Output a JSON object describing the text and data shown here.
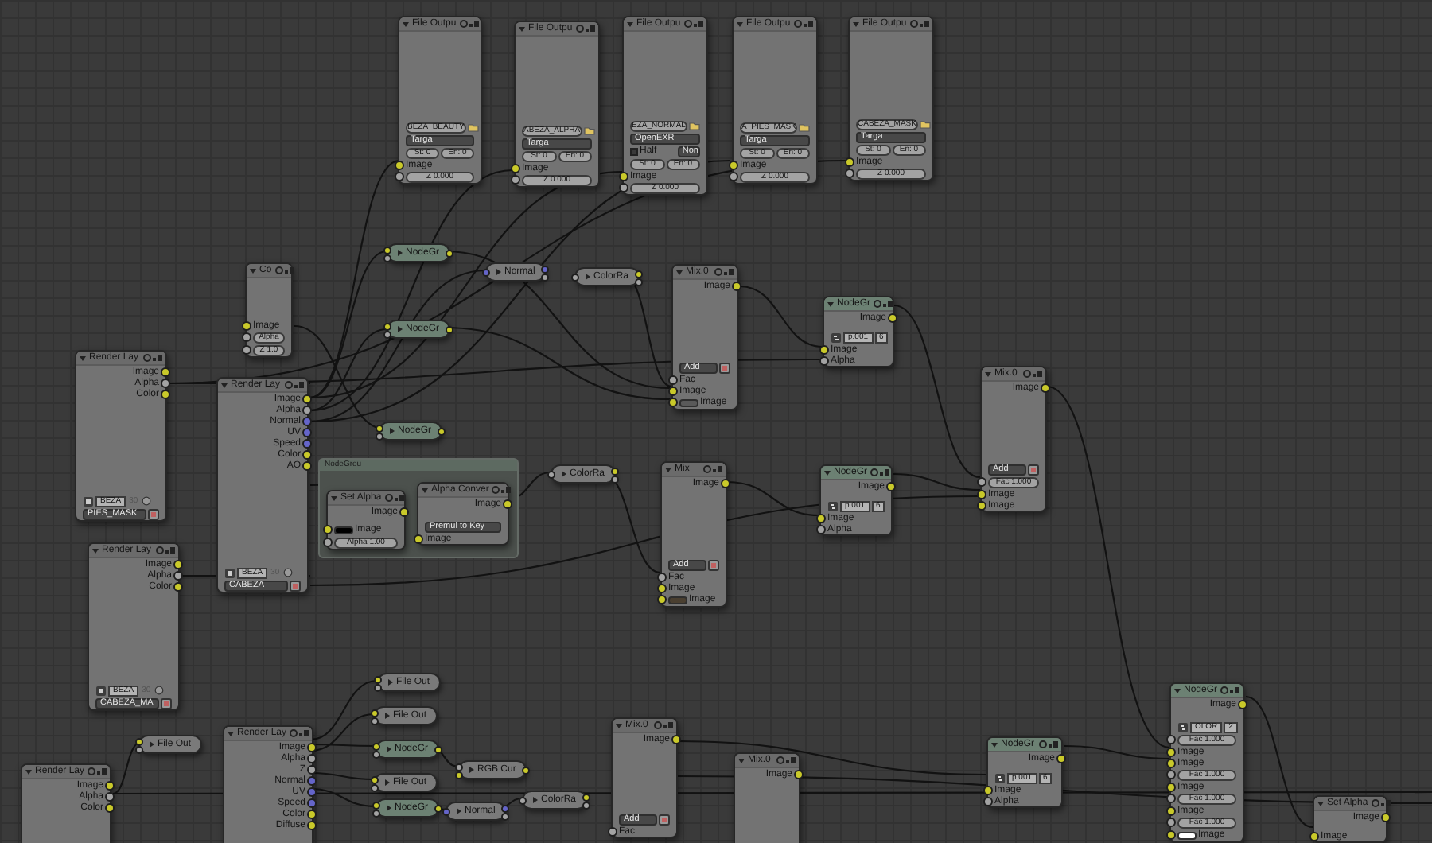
{
  "nodes": [
    {
      "kind": "node",
      "title": "File Outpu",
      "group": false,
      "rows": [
        {
          "kind": "path",
          "value": "BEZA_BEAUTY"
        },
        {
          "kind": "dropdown",
          "value": "Targa",
          "button": false
        },
        {
          "kind": "pair",
          "values": [
            "St: 0",
            "En: 0"
          ]
        },
        {
          "kind": "in",
          "label": "Image",
          "color": "#c9c92a"
        },
        {
          "kind": "field",
          "value": "Z 0.000",
          "color": "#a3a3a3"
        }
      ]
    },
    {
      "kind": "node",
      "title": "File Outpu",
      "group": false,
      "rows": [
        {
          "kind": "path",
          "value": "ABEZA_ALPHA"
        },
        {
          "kind": "dropdown",
          "value": "Targa",
          "button": false
        },
        {
          "kind": "pair",
          "values": [
            "St: 0",
            "En: 0"
          ]
        },
        {
          "kind": "in",
          "label": "Image",
          "color": "#c9c92a"
        },
        {
          "kind": "field",
          "value": "Z 0.000",
          "color": "#a3a3a3"
        }
      ]
    },
    {
      "kind": "node",
      "title": "File Outpu",
      "group": false,
      "rows": [
        {
          "kind": "path",
          "value": "EZA_NORMAL"
        },
        {
          "kind": "dropdown",
          "value": "OpenEXR",
          "button": false
        },
        {
          "kind": "check",
          "label": "Half",
          "checked": false,
          "value": "Non"
        },
        {
          "kind": "pair",
          "values": [
            "St: 0",
            "En: 0"
          ]
        },
        {
          "kind": "in",
          "label": "Image",
          "color": "#c9c92a"
        },
        {
          "kind": "field",
          "value": "Z 0.000",
          "color": "#a3a3a3"
        }
      ]
    },
    {
      "kind": "node",
      "title": "File Outpu",
      "group": false,
      "rows": [
        {
          "kind": "path",
          "value": "A_PIES_MASK"
        },
        {
          "kind": "dropdown",
          "value": "Targa",
          "button": false
        },
        {
          "kind": "pair",
          "values": [
            "St: 0",
            "En: 0"
          ]
        },
        {
          "kind": "in",
          "label": "Image",
          "color": "#c9c92a"
        },
        {
          "kind": "field",
          "value": "Z 0.000",
          "color": "#a3a3a3"
        }
      ]
    },
    {
      "kind": "node",
      "title": "File Outpu",
      "group": false,
      "rows": [
        {
          "kind": "path",
          "value": "CABEZA_MASK"
        },
        {
          "kind": "dropdown",
          "value": "Targa",
          "button": false
        },
        {
          "kind": "pair",
          "values": [
            "St: 0",
            "En: 0"
          ]
        },
        {
          "kind": "in",
          "label": "Image",
          "color": "#c9c92a"
        },
        {
          "kind": "field",
          "value": "Z 0.000",
          "color": "#a3a3a3"
        }
      ]
    },
    {
      "kind": "node",
      "title": "Co",
      "group": false,
      "rows": [
        {
          "kind": "in",
          "label": "Image",
          "color": "#c9c92a"
        },
        {
          "kind": "field",
          "value": "Alpha",
          "color": "#a3a3a3"
        },
        {
          "kind": "field",
          "value": "Z 1.0",
          "color": "#a3a3a3"
        }
      ]
    },
    {
      "kind": "collapsed",
      "title": "NodeGr",
      "group": true,
      "inputs": [
        {
          "color": "#c9c92a"
        },
        {
          "color": "#a3a3a3"
        }
      ],
      "outputs": [
        {
          "color": "#c9c92a"
        }
      ]
    },
    {
      "kind": "collapsed",
      "title": "Normal",
      "group": false,
      "inputs": [
        {
          "color": "#6565c9"
        }
      ],
      "outputs": [
        {
          "color": "#6565c9"
        },
        {
          "color": "#a3a3a3"
        }
      ]
    },
    {
      "kind": "collapsed",
      "title": "ColorRa",
      "group": false,
      "inputs": [
        {
          "color": "#a3a3a3"
        }
      ],
      "outputs": [
        {
          "color": "#c9c92a"
        },
        {
          "color": "#a3a3a3"
        }
      ]
    },
    {
      "kind": "collapsed",
      "title": "NodeGr",
      "group": true,
      "inputs": [
        {
          "color": "#c9c92a"
        },
        {
          "color": "#a3a3a3"
        }
      ],
      "outputs": [
        {
          "color": "#c9c92a"
        }
      ]
    },
    {
      "kind": "node",
      "title": "Render Lay",
      "group": false,
      "rows": [
        {
          "kind": "out",
          "label": "Image",
          "color": "#c9c92a"
        },
        {
          "kind": "out",
          "label": "Alpha",
          "color": "#a3a3a3"
        },
        {
          "kind": "out",
          "label": "Color",
          "color": "#c9c92a"
        },
        {
          "kind": "layers",
          "layer": "BEZA",
          "number": "30"
        },
        {
          "kind": "dropdown",
          "value": "PIES_MASK",
          "button": true
        }
      ]
    },
    {
      "kind": "node",
      "title": "Render Lay",
      "group": false,
      "rows": [
        {
          "kind": "out",
          "label": "Image",
          "color": "#c9c92a"
        },
        {
          "kind": "out",
          "label": "Alpha",
          "color": "#a3a3a3"
        },
        {
          "kind": "out",
          "label": "Normal",
          "color": "#6565c9"
        },
        {
          "kind": "out",
          "label": "UV",
          "color": "#6565c9"
        },
        {
          "kind": "out",
          "label": "Speed",
          "color": "#6565c9"
        },
        {
          "kind": "out",
          "label": "Color",
          "color": "#c9c92a"
        },
        {
          "kind": "out",
          "label": "AO",
          "color": "#c9c92a"
        },
        {
          "kind": "layers",
          "layer": "BEZA",
          "number": "30"
        },
        {
          "kind": "dropdown",
          "value": "CABEZA",
          "button": true
        }
      ]
    },
    {
      "kind": "collapsed",
      "title": "NodeGr",
      "group": true,
      "inputs": [
        {
          "color": "#c9c92a"
        },
        {
          "color": "#a3a3a3"
        }
      ],
      "outputs": [
        {
          "color": "#c9c92a"
        }
      ]
    },
    {
      "kind": "frame",
      "title": "NodeGrou",
      "nodes": [
        {
          "kind": "node",
          "title": "Set Alpha",
          "group": false,
          "rows": [
            {
              "kind": "out",
              "label": "Image",
              "color": "#c9c92a"
            },
            {
              "kind": "swatch",
              "label": "Image",
              "color": "#000000",
              "socket": {
                "color": "#c9c92a"
              }
            },
            {
              "kind": "field",
              "value": "Alpha 1.00",
              "color": "#a3a3a3"
            }
          ]
        },
        {
          "kind": "node",
          "title": "Alpha Conver",
          "group": false,
          "rows": [
            {
              "kind": "out",
              "label": "Image",
              "color": "#c9c92a"
            },
            {
              "kind": "dropdown",
              "value": "Premul to Key",
              "button": false
            },
            {
              "kind": "in",
              "label": "Image",
              "color": "#c9c92a"
            }
          ]
        }
      ]
    },
    {
      "kind": "collapsed",
      "title": "ColorRa",
      "group": false,
      "inputs": [
        {
          "color": "#a3a3a3"
        }
      ],
      "outputs": [
        {
          "color": "#c9c92a"
        },
        {
          "color": "#a3a3a3"
        }
      ]
    },
    {
      "kind": "node",
      "title": "Mix.0",
      "group": false,
      "rows": [
        {
          "kind": "out",
          "label": "Image",
          "color": "#c9c92a"
        },
        {
          "kind": "dropdown",
          "value": "Add",
          "button": true
        },
        {
          "kind": "in",
          "label": "Fac",
          "color": "#a3a3a3"
        },
        {
          "kind": "in",
          "label": "Image",
          "color": "#c9c92a"
        },
        {
          "kind": "swatch",
          "label": "Image",
          "color": "#595959",
          "socket": {
            "color": "#c9c92a"
          }
        }
      ]
    },
    {
      "kind": "node",
      "title": "NodeGr",
      "group": true,
      "rows": [
        {
          "kind": "out",
          "label": "Image",
          "color": "#c9c92a"
        },
        {
          "kind": "datablock",
          "value": "p.001",
          "users": "6"
        },
        {
          "kind": "in",
          "label": "Image",
          "color": "#c9c92a"
        },
        {
          "kind": "in",
          "label": "Alpha",
          "color": "#a3a3a3"
        }
      ]
    },
    {
      "kind": "node",
      "title": "Mix",
      "group": false,
      "rows": [
        {
          "kind": "out",
          "label": "Image",
          "color": "#c9c92a"
        },
        {
          "kind": "dropdown",
          "value": "Add",
          "button": true
        },
        {
          "kind": "in",
          "label": "Fac",
          "color": "#a3a3a3"
        },
        {
          "kind": "in",
          "label": "Image",
          "color": "#c9c92a"
        },
        {
          "kind": "swatch",
          "label": "Image",
          "color": "#4a3f30",
          "socket": {
            "color": "#c9c92a"
          }
        }
      ]
    },
    {
      "kind": "node",
      "title": "NodeGr",
      "group": true,
      "rows": [
        {
          "kind": "out",
          "label": "Image",
          "color": "#c9c92a"
        },
        {
          "kind": "datablock",
          "value": "p.001",
          "users": "6"
        },
        {
          "kind": "in",
          "label": "Image",
          "color": "#c9c92a"
        },
        {
          "kind": "in",
          "label": "Alpha",
          "color": "#a3a3a3"
        }
      ]
    },
    {
      "kind": "node",
      "title": "Mix.0",
      "group": false,
      "rows": [
        {
          "kind": "out",
          "label": "Image",
          "color": "#c9c92a"
        },
        {
          "kind": "dropdown",
          "value": "Add",
          "button": true
        },
        {
          "kind": "field",
          "value": "Fac 1.000",
          "color": "#a3a3a3"
        },
        {
          "kind": "in",
          "label": "Image",
          "color": "#c9c92a"
        },
        {
          "kind": "in",
          "label": "Image",
          "color": "#c9c92a"
        }
      ]
    },
    {
      "kind": "node",
      "title": "Render Lay",
      "group": false,
      "rows": [
        {
          "kind": "out",
          "label": "Image",
          "color": "#c9c92a"
        },
        {
          "kind": "out",
          "label": "Alpha",
          "color": "#a3a3a3"
        },
        {
          "kind": "out",
          "label": "Color",
          "color": "#c9c92a"
        },
        {
          "kind": "layers",
          "layer": "BEZA",
          "number": "30"
        },
        {
          "kind": "dropdown",
          "value": "CABEZA_MA",
          "button": true
        }
      ]
    },
    {
      "kind": "collapsed",
      "title": "File Out",
      "group": false,
      "inputs": [
        {
          "color": "#c9c92a"
        },
        {
          "color": "#a3a3a3"
        }
      ]
    },
    {
      "kind": "node",
      "title": "Render Lay",
      "group": false,
      "rows": [
        {
          "kind": "out",
          "label": "Image",
          "color": "#c9c92a"
        },
        {
          "kind": "out",
          "label": "Alpha",
          "color": "#a3a3a3"
        },
        {
          "kind": "out",
          "label": "Color",
          "color": "#c9c92a"
        }
      ]
    },
    {
      "kind": "node",
      "title": "Render Lay",
      "group": false,
      "rows": [
        {
          "kind": "out",
          "label": "Image",
          "color": "#c9c92a"
        },
        {
          "kind": "out",
          "label": "Alpha",
          "color": "#a3a3a3"
        },
        {
          "kind": "out",
          "label": "Z",
          "color": "#a3a3a3"
        },
        {
          "kind": "out",
          "label": "Normal",
          "color": "#6565c9"
        },
        {
          "kind": "out",
          "label": "UV",
          "color": "#6565c9"
        },
        {
          "kind": "out",
          "label": "Speed",
          "color": "#6565c9"
        },
        {
          "kind": "out",
          "label": "Color",
          "color": "#c9c92a"
        },
        {
          "kind": "out",
          "label": "Diffuse",
          "color": "#c9c92a"
        }
      ]
    },
    {
      "kind": "collapsed",
      "title": "File Out",
      "group": false,
      "inputs": [
        {
          "color": "#c9c92a"
        },
        {
          "color": "#a3a3a3"
        }
      ]
    },
    {
      "kind": "collapsed",
      "title": "File Out",
      "group": false,
      "inputs": [
        {
          "color": "#c9c92a"
        },
        {
          "color": "#a3a3a3"
        }
      ]
    },
    {
      "kind": "collapsed",
      "title": "NodeGr",
      "group": true,
      "inputs": [
        {
          "color": "#c9c92a"
        },
        {
          "color": "#a3a3a3"
        }
      ],
      "outputs": [
        {
          "color": "#c9c92a"
        }
      ]
    },
    {
      "kind": "collapsed",
      "title": "File Out",
      "group": false,
      "inputs": [
        {
          "color": "#c9c92a"
        },
        {
          "color": "#a3a3a3"
        }
      ]
    },
    {
      "kind": "collapsed",
      "title": "NodeGr",
      "group": true,
      "inputs": [
        {
          "color": "#c9c92a"
        },
        {
          "color": "#a3a3a3"
        }
      ],
      "outputs": [
        {
          "color": "#c9c92a"
        }
      ]
    },
    {
      "kind": "collapsed",
      "title": "RGB Cur",
      "group": false,
      "inputs": [
        {
          "color": "#a3a3a3"
        },
        {
          "color": "#c9c92a"
        }
      ],
      "outputs": [
        {
          "color": "#c9c92a"
        }
      ]
    },
    {
      "kind": "collapsed",
      "title": "Normal",
      "group": false,
      "inputs": [
        {
          "color": "#6565c9"
        }
      ],
      "outputs": [
        {
          "color": "#6565c9"
        },
        {
          "color": "#a3a3a3"
        }
      ]
    },
    {
      "kind": "collapsed",
      "title": "ColorRa",
      "group": false,
      "inputs": [
        {
          "color": "#a3a3a3"
        }
      ],
      "outputs": [
        {
          "color": "#c9c92a"
        },
        {
          "color": "#a3a3a3"
        }
      ]
    },
    {
      "kind": "node",
      "title": "Mix.0",
      "group": false,
      "rows": [
        {
          "kind": "out",
          "label": "Image",
          "color": "#c9c92a"
        },
        {
          "kind": "dropdown",
          "value": "Add",
          "button": true
        },
        {
          "kind": "in",
          "label": "Fac",
          "color": "#a3a3a3"
        }
      ]
    },
    {
      "kind": "node",
      "title": "Mix.0",
      "group": false,
      "rows": [
        {
          "kind": "out",
          "label": "Image",
          "color": "#c9c92a"
        }
      ]
    },
    {
      "kind": "node",
      "title": "NodeGr",
      "group": true,
      "rows": [
        {
          "kind": "out",
          "label": "Image",
          "color": "#c9c92a"
        },
        {
          "kind": "datablock",
          "value": "p.001",
          "users": "6"
        },
        {
          "kind": "in",
          "label": "Image",
          "color": "#c9c92a"
        },
        {
          "kind": "in",
          "label": "Alpha",
          "color": "#a3a3a3"
        }
      ]
    },
    {
      "kind": "node",
      "title": "NodeGr",
      "group": true,
      "rows": [
        {
          "kind": "out",
          "label": "Image",
          "color": "#c9c92a"
        },
        {
          "kind": "datablock",
          "value": "OLOR",
          "users": "2"
        },
        {
          "kind": "field",
          "value": "Fac 1.000",
          "color": "#a3a3a3"
        },
        {
          "kind": "in",
          "label": "Image",
          "color": "#c9c92a"
        },
        {
          "kind": "in",
          "label": "Image",
          "color": "#c9c92a"
        },
        {
          "kind": "field",
          "value": "Fac 1.000",
          "color": "#a3a3a3"
        },
        {
          "kind": "in",
          "label": "Image",
          "color": "#c9c92a"
        },
        {
          "kind": "field",
          "value": "Fac 1.000",
          "color": "#a3a3a3"
        },
        {
          "kind": "in",
          "label": "Image",
          "color": "#c9c92a"
        },
        {
          "kind": "field",
          "value": "Fac 1.000",
          "color": "#a3a3a3"
        },
        {
          "kind": "swatch",
          "label": "Image",
          "color": "#ffffff",
          "socket": {
            "color": "#c9c92a"
          }
        }
      ]
    },
    {
      "kind": "node",
      "title": "Set Alpha",
      "group": false,
      "rows": [
        {
          "kind": "out",
          "label": "Image",
          "color": "#c9c92a"
        },
        {
          "kind": "in",
          "label": "Image",
          "color": "#c9c92a"
        }
      ]
    }
  ]
}
